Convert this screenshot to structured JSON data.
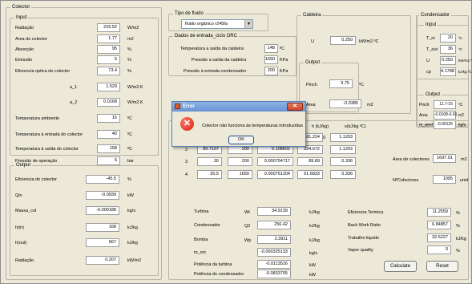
{
  "collector": {
    "title": "Colector",
    "input": {
      "title": "Input",
      "rows": [
        {
          "label": "Radiação",
          "value": "229.52",
          "unit": "W/m2"
        },
        {
          "label": "Area do colector",
          "value": "1.77",
          "unit": "m2"
        },
        {
          "label": "Absorção",
          "value": "95",
          "unit": "%"
        },
        {
          "label": "Emissão",
          "value": "5",
          "unit": "%"
        },
        {
          "label": "Eficiencia optica do colector",
          "value": "73.4",
          "unit": "%"
        },
        {
          "label": "a_1",
          "value": "1.529",
          "unit": "W/m2.K"
        },
        {
          "label": "a_2",
          "value": "0.0168",
          "unit": "W/m2.K"
        },
        {
          "label": "Temperatura ambiente",
          "value": "15",
          "unit": "ºC"
        },
        {
          "label": "Temperatura à entrada do colector",
          "value": "40",
          "unit": "ºC"
        },
        {
          "label": "Temperatura à saída do colector",
          "value": "158",
          "unit": "ºC"
        },
        {
          "label": "Pressão de operação",
          "value": "6",
          "unit": "bar"
        }
      ]
    },
    "output": {
      "title": "Output",
      "rows": [
        {
          "label": "Eficiencia do colector",
          "value": "-45.5",
          "unit": "%"
        },
        {
          "label": "Qin",
          "value": "-0.0939",
          "unit": "kW"
        },
        {
          "label": "Massa_col",
          "value": "-0.000188",
          "unit": "kg/s"
        },
        {
          "label": "h(in)",
          "value": "168",
          "unit": "kJ/kg"
        },
        {
          "label": "h(out)",
          "value": "667",
          "unit": "kJ/kg"
        },
        {
          "label": "Radiação",
          "value": "0.207",
          "unit": "kW/m2"
        }
      ]
    }
  },
  "fluid": {
    "title": "Tipo de fluido",
    "selected": "fluido orgânico r245fa",
    "arrow": "▼"
  },
  "orc": {
    "title": "Dados de entrada_ciclo ORC",
    "rows": [
      {
        "label": "Temperatura a saída da caldeira",
        "value": "148",
        "unit": "ºC"
      },
      {
        "label": "Pressão a saída da caldeira",
        "value": "1650",
        "unit": "KPa"
      },
      {
        "label": "Pressão à entrada condensador",
        "value": "200",
        "unit": "KPa"
      }
    ]
  },
  "boiler": {
    "title": "Caldeira",
    "u_label": "U",
    "u_value": "0.250",
    "u_unit": "kW/m2.ºC",
    "output_title": "Output",
    "pinch_label": "Pinch",
    "pinch_value": "9.75",
    "pinch_unit": "ºC",
    "area_label": "Area",
    "area_value": "-0.0385",
    "area_unit": "m2"
  },
  "condenser": {
    "title": "Condensador",
    "input_title": "Input",
    "rows": [
      {
        "label": "T_in",
        "value": "20",
        "unit": "ºC"
      },
      {
        "label": "T_out",
        "value": "36",
        "unit": "ºC"
      },
      {
        "label": "U",
        "value": "0.250",
        "unit": "kW/m2.ºC"
      },
      {
        "label": "cp",
        "value": "4.1788",
        "unit": "kJ/kg.ºC"
      }
    ],
    "output_title": "Output",
    "out_rows": [
      {
        "label": "Pinch",
        "value": "11.7-15",
        "unit": "ºC"
      },
      {
        "label": "Area",
        "value": "-0.0108-0.01",
        "unit": "m2"
      },
      {
        "label": "m_arref",
        "value": "-0.00125",
        "unit": "kg/s"
      }
    ]
  },
  "states": {
    "headers": [
      "Estado",
      "T (ºC)",
      "P(KPa)",
      "v (m3/kg)",
      "h (kJ/kg)",
      "s(kJ/kg ºC)"
    ],
    "rows": [
      [
        "1",
        "148",
        "1650",
        "0.012826",
        "381.224",
        "1.1203"
      ],
      [
        "2",
        "89.7107",
        "200",
        "0.108602",
        "334.672",
        "1.1203"
      ],
      [
        "3",
        "30",
        "200",
        "0.000754717",
        "89.89",
        "0.336"
      ],
      [
        "4",
        "30.5",
        "1650",
        "0.000751204",
        "91.6833",
        "0.336"
      ]
    ],
    "h1_extra": "0"
  },
  "collectors": {
    "area_label": "Area de colectores",
    "area_value": "1697.01",
    "area_unit": "m2",
    "n_label": "NºColectores",
    "n_value": "1095",
    "n_unit": "unid"
  },
  "results": {
    "left": [
      {
        "label": "Turbina",
        "sym": "Wt",
        "value": "34.9139",
        "unit": "kJ/kg"
      },
      {
        "label": "Condensador",
        "sym": "Q2",
        "value": "256.42",
        "unit": "kJ/kg"
      },
      {
        "label": "Bomba",
        "sym": "Wp",
        "value": "2.3911",
        "unit": "kJ/kg"
      },
      {
        "label": "m_orc",
        "sym": "",
        "value": "-0.000325133",
        "unit": "kg/s"
      },
      {
        "label": "Potência da turbina",
        "sym": "",
        "value": "-0.0113516",
        "unit": "kW"
      },
      {
        "label": "Potência do condensador",
        "sym": "",
        "value": "-0.0833705",
        "unit": "kW"
      }
    ],
    "right": [
      {
        "label": "Eficiencia Termica",
        "value": "11.2559",
        "unit": "%"
      },
      {
        "label": "Back Work Ratio",
        "value": "6.84857",
        "unit": "%"
      },
      {
        "label": "Trabalho liquido",
        "value": "32.5227",
        "unit": "kJ/kg"
      },
      {
        "label": "Vapor quality",
        "value": "0",
        "unit": "%"
      }
    ]
  },
  "buttons": {
    "calculate": "Calculate",
    "reset": "Reset"
  },
  "dialog": {
    "title": "Error",
    "message": "Colector não funciona às temperaturas introduzidas",
    "ok": "OK",
    "close_glyph": "✕",
    "icon_glyph": "✕"
  }
}
